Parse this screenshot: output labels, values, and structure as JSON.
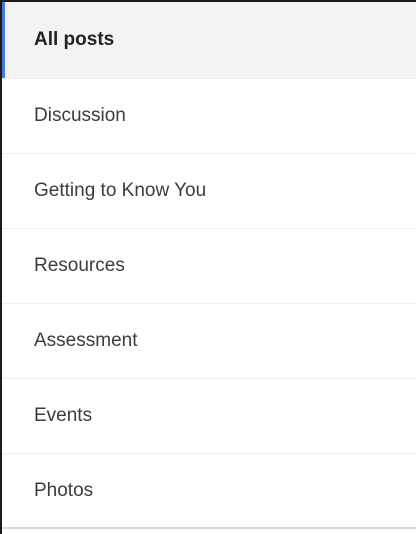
{
  "categories": {
    "items": [
      {
        "label": "All posts",
        "selected": true
      },
      {
        "label": "Discussion",
        "selected": false
      },
      {
        "label": "Getting to Know You",
        "selected": false
      },
      {
        "label": "Resources",
        "selected": false
      },
      {
        "label": "Assessment",
        "selected": false
      },
      {
        "label": "Events",
        "selected": false
      },
      {
        "label": "Photos",
        "selected": false
      }
    ]
  },
  "colors": {
    "selected_indicator": "#4a7bd8",
    "selected_background": "#f3f3f3"
  }
}
